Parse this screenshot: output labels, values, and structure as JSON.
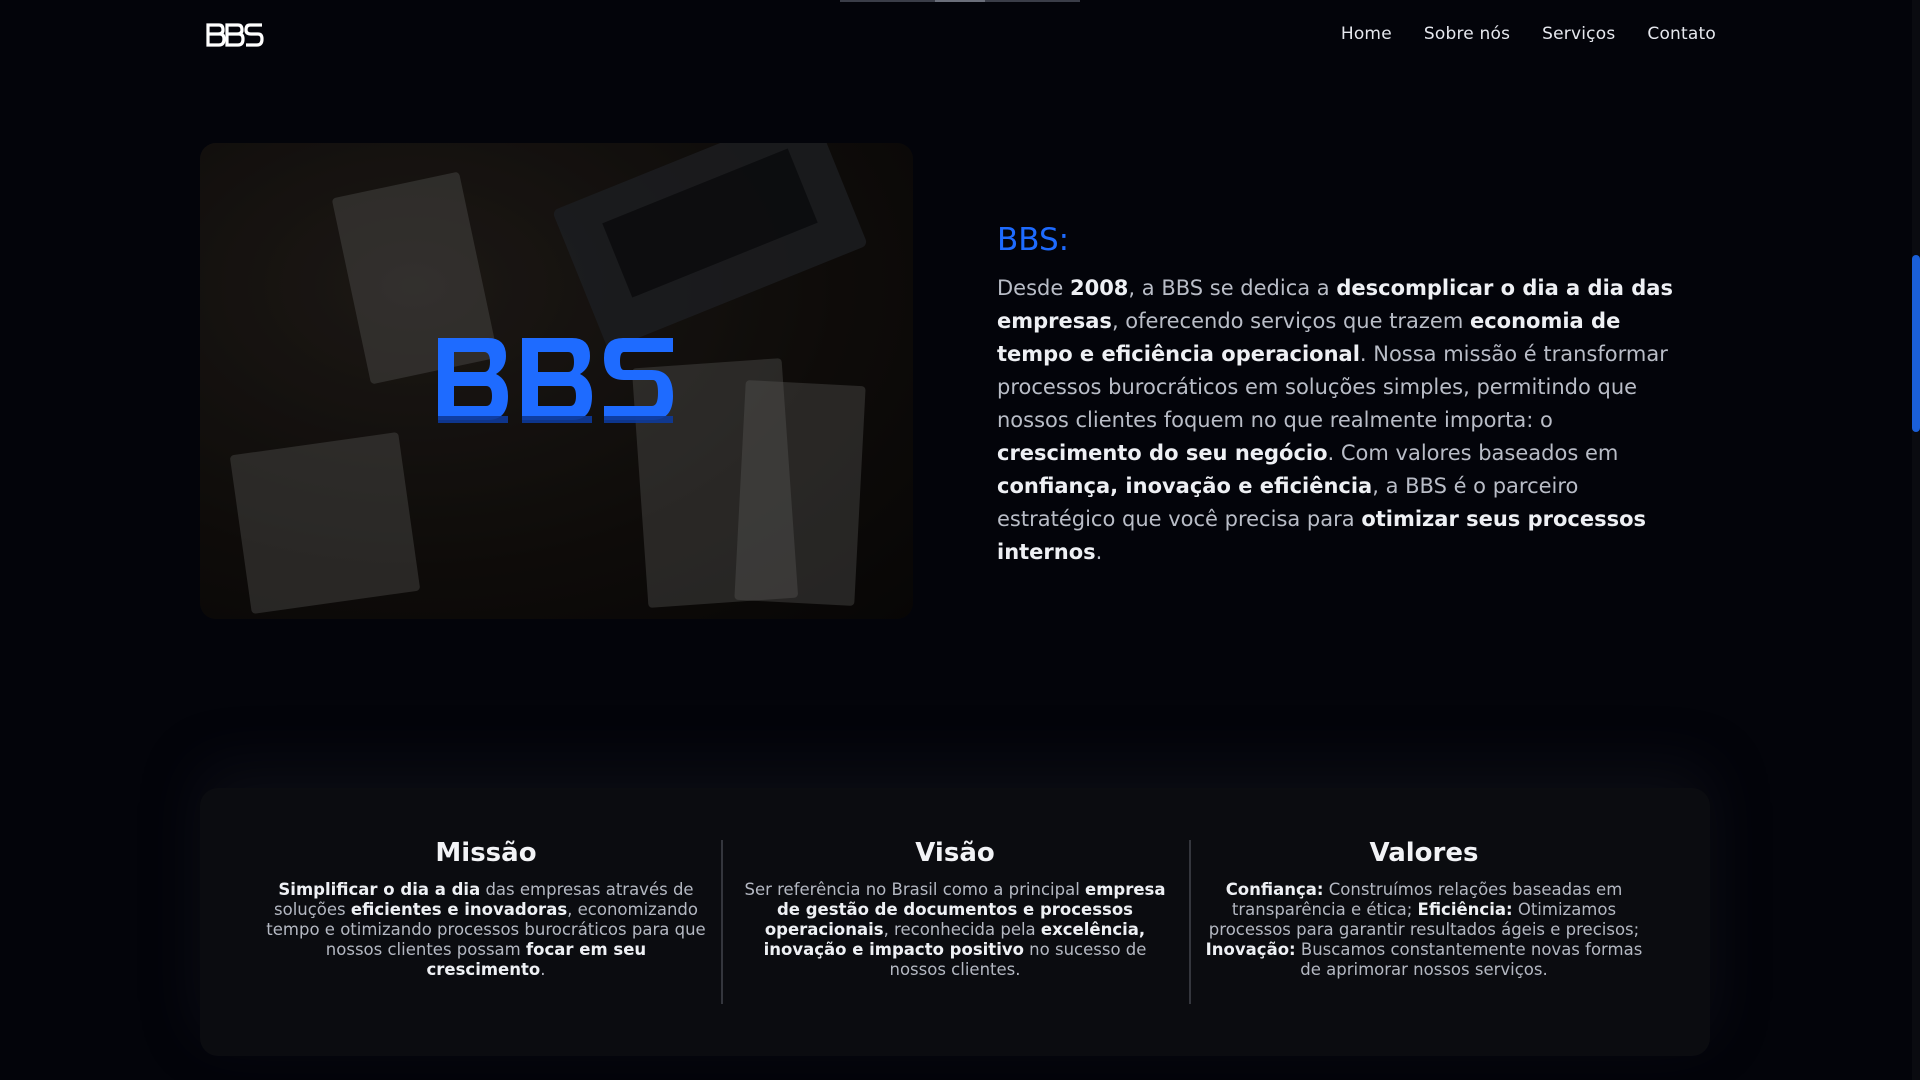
{
  "header": {
    "logo_text": "BBS",
    "nav": [
      "Home",
      "Sobre nós",
      "Serviços",
      "Contato"
    ]
  },
  "hero": {
    "logo_text": "BBS"
  },
  "about": {
    "title": "BBS:",
    "paragraph": [
      {
        "t": "Desde ",
        "b": false
      },
      {
        "t": "2008",
        "b": true
      },
      {
        "t": ", a BBS se dedica a ",
        "b": false
      },
      {
        "t": "descomplicar o dia a dia das empresas",
        "b": true
      },
      {
        "t": ", oferecendo serviços que trazem ",
        "b": false
      },
      {
        "t": "economia de tempo e eficiência operacional",
        "b": true
      },
      {
        "t": ". Nossa missão é transformar processos burocráticos em soluções simples, permitindo que nossos clientes foquem no que realmente importa: o ",
        "b": false
      },
      {
        "t": "crescimento do seu negócio",
        "b": true
      },
      {
        "t": ". Com valores baseados em ",
        "b": false
      },
      {
        "t": "confiança, inovação e eficiência",
        "b": true
      },
      {
        "t": ", a BBS é o parceiro estratégico que você precisa para ",
        "b": false
      },
      {
        "t": "otimizar seus processos internos",
        "b": true
      },
      {
        "t": ".",
        "b": false
      }
    ]
  },
  "cards": [
    {
      "title": "Missão",
      "text": [
        {
          "t": "Simplificar o dia a dia",
          "b": true
        },
        {
          "t": " das empresas através de soluções ",
          "b": false
        },
        {
          "t": "eficientes e inovadoras",
          "b": true
        },
        {
          "t": ", economizando tempo e otimizando processos burocráticos para que nossos clientes possam ",
          "b": false
        },
        {
          "t": "focar em seu crescimento",
          "b": true
        },
        {
          "t": ".",
          "b": false
        }
      ]
    },
    {
      "title": "Visão",
      "text": [
        {
          "t": "Ser referência no Brasil como a principal ",
          "b": false
        },
        {
          "t": "empresa de gestão de documentos e processos operacionais",
          "b": true
        },
        {
          "t": ", reconhecida pela ",
          "b": false
        },
        {
          "t": "excelência, inovação e impacto positivo",
          "b": true
        },
        {
          "t": " no sucesso de nossos clientes.",
          "b": false
        }
      ]
    },
    {
      "title": "Valores",
      "text": [
        {
          "t": "Confiança:",
          "b": true
        },
        {
          "t": " Construímos relações baseadas em transparência e ética; ",
          "b": false
        },
        {
          "t": "Eficiência:",
          "b": true
        },
        {
          "t": " Otimizamos processos para garantir resultados ágeis e precisos; ",
          "b": false
        },
        {
          "t": "Inovação:",
          "b": true
        },
        {
          "t": " Buscamos constantemente novas formas de aprimorar nossos serviços.",
          "b": false
        }
      ]
    }
  ],
  "colors": {
    "accent": "#1e6bff",
    "background": "#03040a",
    "card_bg": "#0b0c10"
  }
}
